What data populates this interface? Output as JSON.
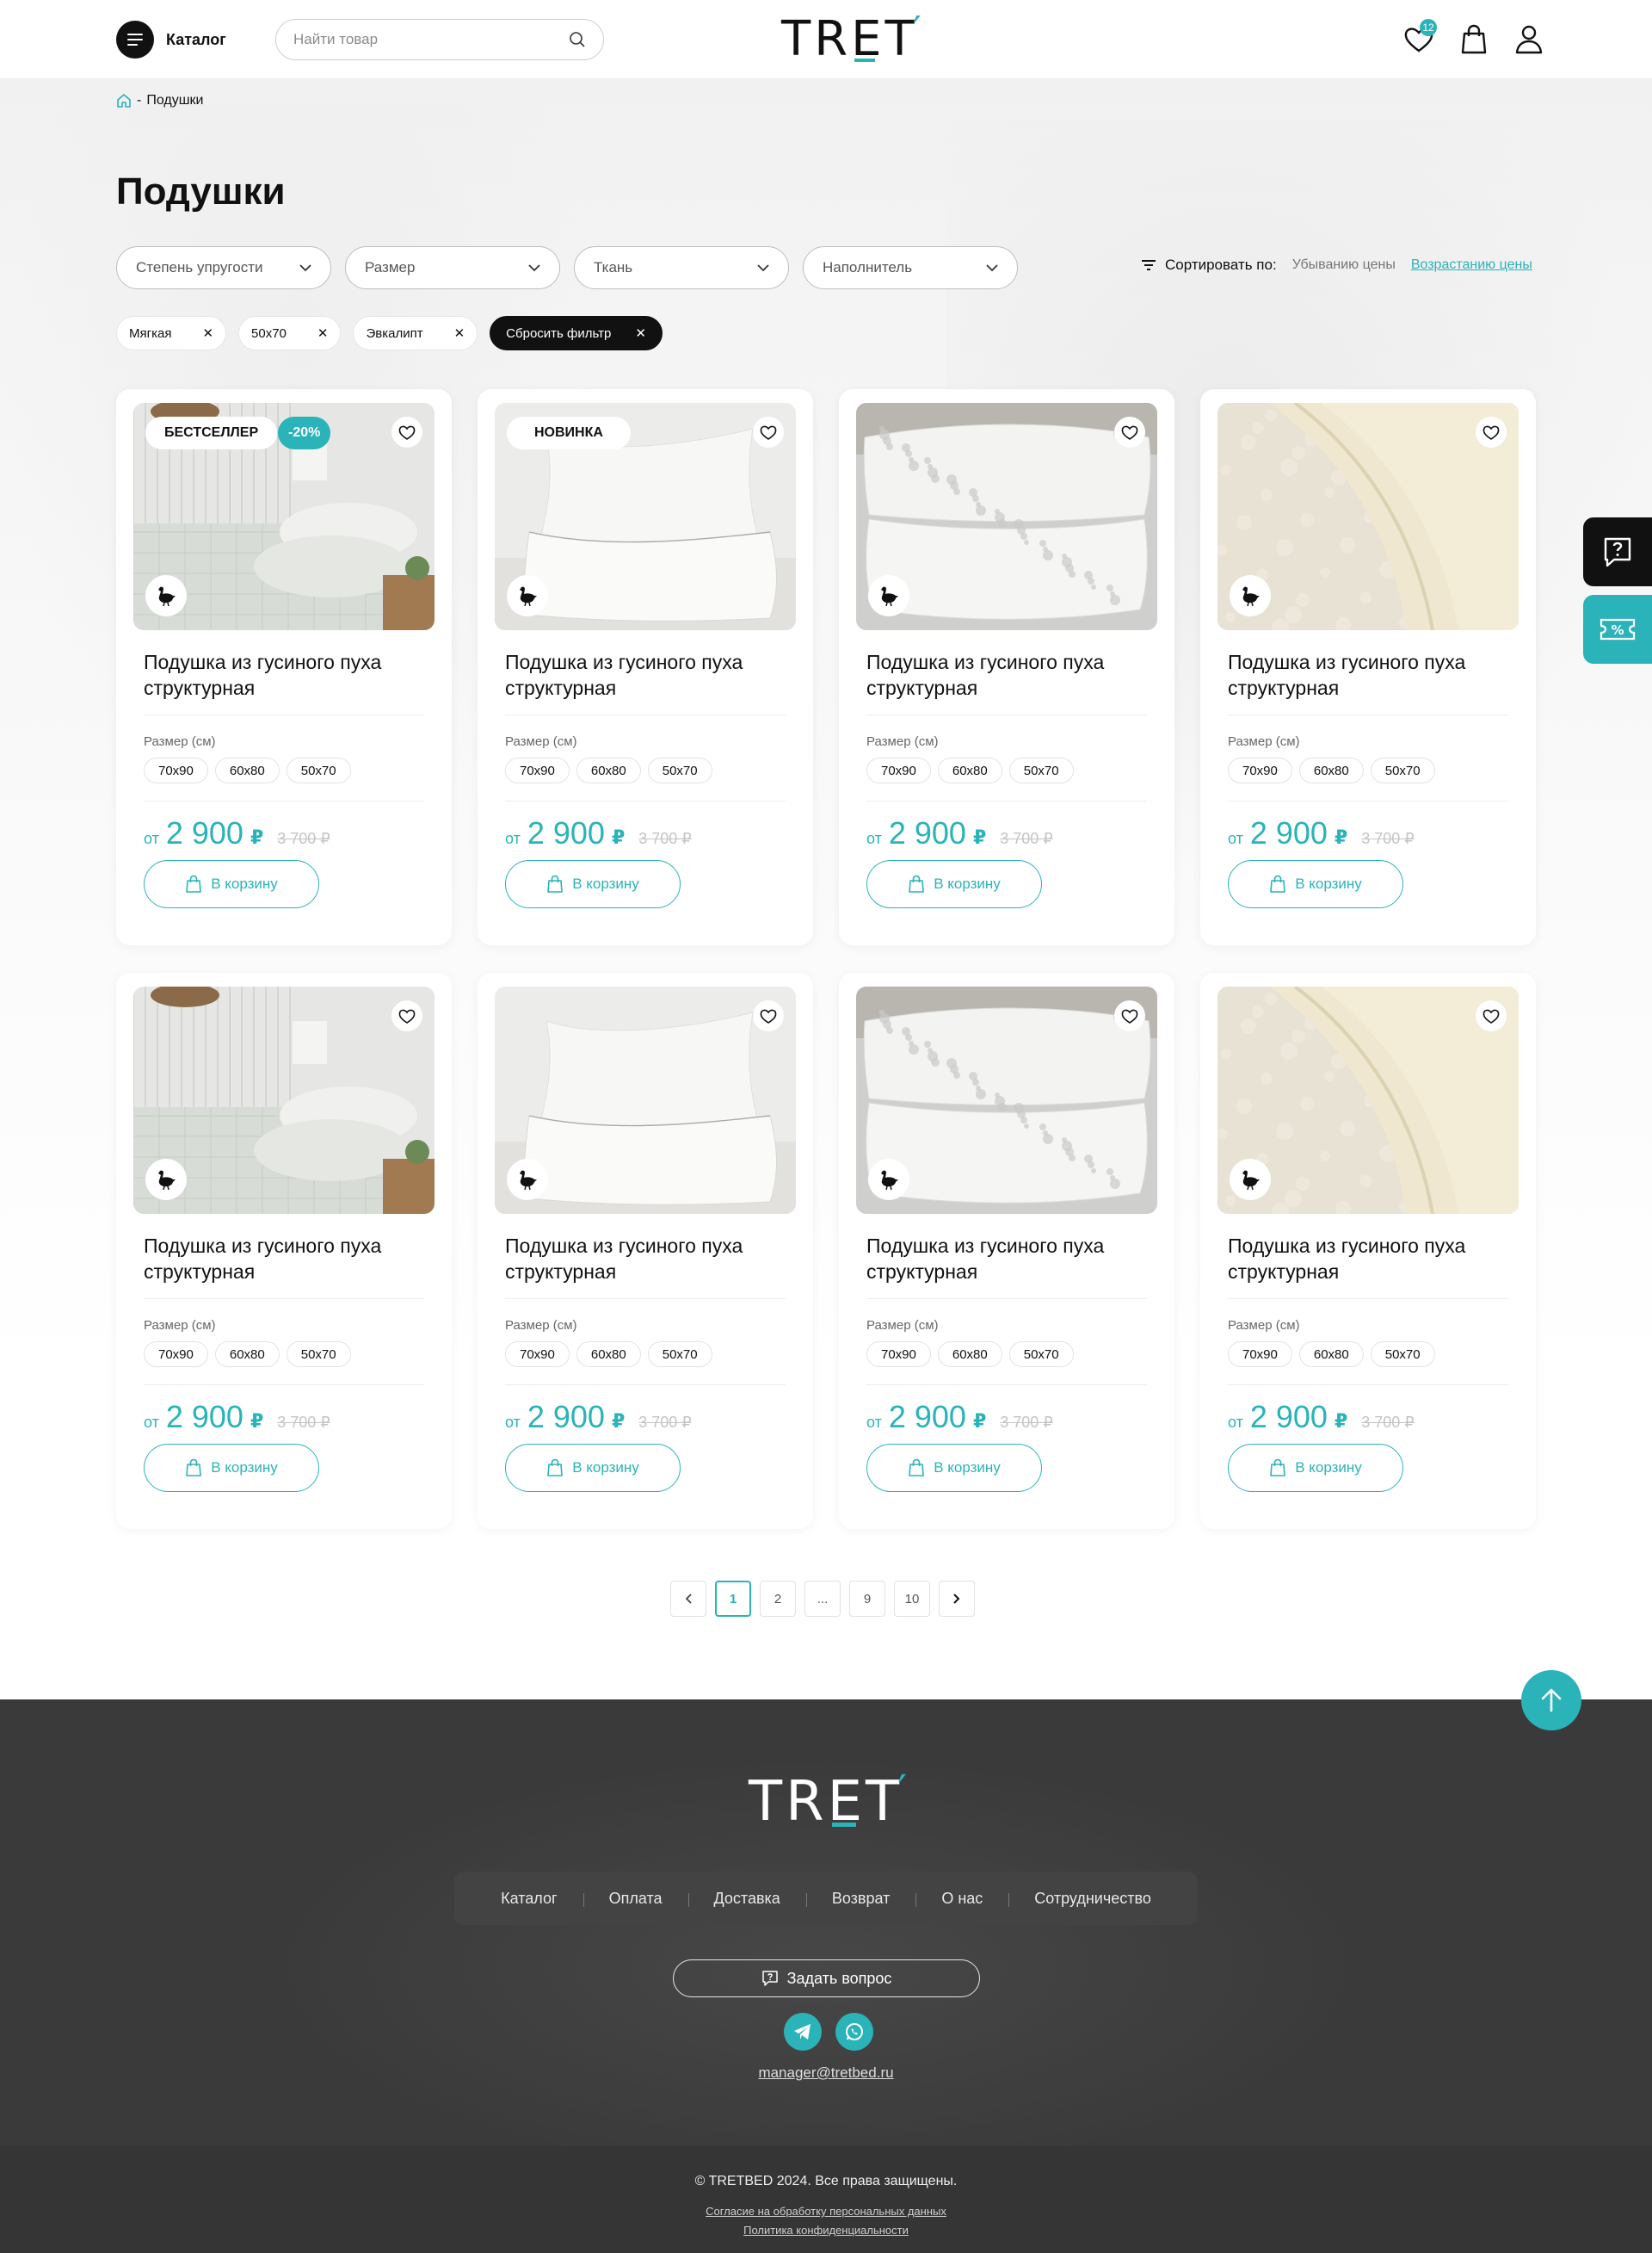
{
  "header": {
    "catalog_label": "Каталог",
    "search_placeholder": "Найти товар",
    "logo": {
      "t": "TR",
      "e": "E",
      "rest": "T",
      "tick": "′"
    },
    "favorites_count": "12"
  },
  "breadcrumb": {
    "current": "Подушки"
  },
  "page_title": "Подушки",
  "filters": [
    "Степень упругости",
    "Размер",
    "Ткань",
    "Наполнитель"
  ],
  "sort": {
    "label": "Сортировать по:",
    "options": [
      {
        "label": "Убыванию цены",
        "active": false
      },
      {
        "label": "Возрастанию цены",
        "active": true
      }
    ]
  },
  "active_filters": [
    "Мягкая",
    "50x70",
    "Эвкалипт"
  ],
  "reset_filter": "Сбросить фильтр",
  "product_common": {
    "size_label": "Размер (см)",
    "from": "от",
    "currency": "₽",
    "cart_label": "В корзину"
  },
  "products": [
    {
      "name": "Подушка из гусиного пуха структурная",
      "badges": [
        "БЕСТСЕЛЛЕР",
        "-20%"
      ],
      "sizes": [
        "70x90",
        "60x80",
        "50x70"
      ],
      "price": "2 900",
      "old_price": "3 700 ₽",
      "image": "bedroom"
    },
    {
      "name": "Подушка из гусиного пуха структурная",
      "badges": [
        "НОВИНКА"
      ],
      "sizes": [
        "70x90",
        "60x80",
        "50x70"
      ],
      "price": "2 900",
      "old_price": "3 700 ₽",
      "image": "white-pillows"
    },
    {
      "name": "Подушка из гусиного пуха структурная",
      "badges": [],
      "sizes": [
        "70x90",
        "60x80",
        "50x70"
      ],
      "price": "2 900",
      "old_price": "3 700 ₽",
      "image": "pattern-pillows"
    },
    {
      "name": "Подушка из гусиного пуха структурная",
      "badges": [],
      "sizes": [
        "70x90",
        "60x80",
        "50x70"
      ],
      "price": "2 900",
      "old_price": "3 700 ₽",
      "image": "wool"
    },
    {
      "name": "Подушка из гусиного пуха структурная",
      "badges": [],
      "sizes": [
        "70x90",
        "60x80",
        "50x70"
      ],
      "price": "2 900",
      "old_price": "3 700 ₽",
      "image": "bedroom"
    },
    {
      "name": "Подушка из гусиного пуха структурная",
      "badges": [],
      "sizes": [
        "70x90",
        "60x80",
        "50x70"
      ],
      "price": "2 900",
      "old_price": "3 700 ₽",
      "image": "white-pillows"
    },
    {
      "name": "Подушка из гусиного пуха структурная",
      "badges": [],
      "sizes": [
        "70x90",
        "60x80",
        "50x70"
      ],
      "price": "2 900",
      "old_price": "3 700 ₽",
      "image": "pattern-pillows"
    },
    {
      "name": "Подушка из гусиного пуха структурная",
      "badges": [],
      "sizes": [
        "70x90",
        "60x80",
        "50x70"
      ],
      "price": "2 900",
      "old_price": "3 700 ₽",
      "image": "wool"
    }
  ],
  "pagination": {
    "pages": [
      "1",
      "2",
      "...",
      "9",
      "10"
    ],
    "current": "1"
  },
  "footer": {
    "nav": [
      "Каталог",
      "Оплата",
      "Доставка",
      "Возврат",
      "О нас",
      "Сотрудничество"
    ],
    "ask_label": "Задать вопрос",
    "email": "manager@tretbed.ru",
    "copyright": "© TRETBED 2024. Все права защищены.",
    "consent_link": "Согласие на обработку персональных данных",
    "privacy_link": "Политика конфиденциальности"
  },
  "colors": {
    "accent": "#2ab3b8",
    "dark": "#111111",
    "footer_bg": "#3a3a3a"
  }
}
